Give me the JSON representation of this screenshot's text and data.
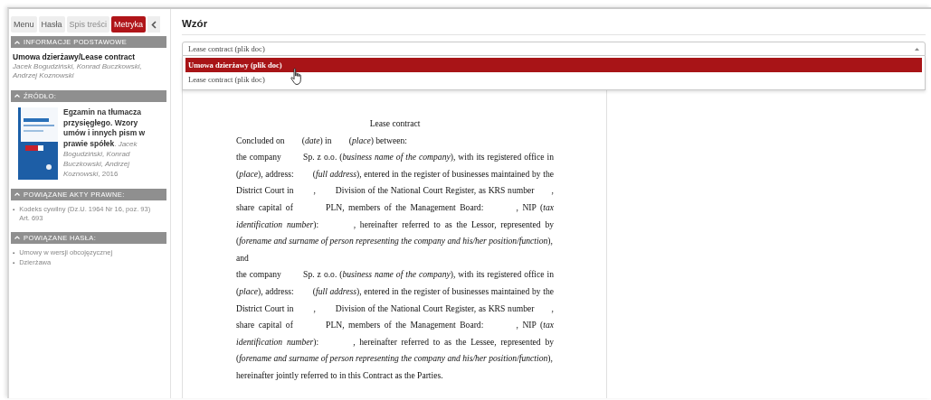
{
  "tabs": [
    {
      "label": "Menu",
      "selected": false,
      "disabled": false
    },
    {
      "label": "Hasła",
      "selected": false,
      "disabled": false
    },
    {
      "label": "Spis treści",
      "selected": false,
      "disabled": true
    },
    {
      "label": "Metryka",
      "selected": true,
      "disabled": false
    }
  ],
  "sidebar": {
    "sections": [
      {
        "kind": "info",
        "title": "INFORMACJE PODSTAWOWE",
        "heading": "Umowa dzierżawy/Lease contract",
        "authors": "Jacek Bogudziński, Konrad Buczkowski, Andrzej Koznowski"
      },
      {
        "kind": "source",
        "title": "ŹRÓDŁO:",
        "text": "**Egzamin na tłumacza przysięgłego. Wzory umów i innych pism w prawie spółek**. *Jacek Bogudziński, Konrad Buczkowski, Andrzej Koznowski*, 2016"
      },
      {
        "kind": "list",
        "title": "POWIĄZANE AKTY PRAWNE:",
        "items": [
          {
            "bullet": "▪",
            "lines": [
              "Kodeks cywilny (Dz.U. 1964 Nr 16, poz. 93)",
              "Art. 693"
            ]
          }
        ]
      },
      {
        "kind": "list",
        "title": "POWIĄZANE HASŁA:",
        "items": [
          {
            "bullet": "▪",
            "lines": [
              "Umowy w wersji obcojęzycznej"
            ]
          },
          {
            "bullet": "▪",
            "lines": [
              "Dzierżawa"
            ]
          }
        ]
      }
    ]
  },
  "main": {
    "title": "Wzór",
    "select": {
      "value": "Lease contract (plik doc)",
      "expanded": true,
      "options": [
        {
          "label": "Umowa dzierżawy (plik doc)",
          "highlighted": true
        },
        {
          "label": "Lease contract (plik doc)",
          "highlighted": false
        }
      ]
    },
    "document": {
      "title": "Lease contract",
      "paragraphs": [
        "Concluded on        (*date*) in        (*place*) between:",
        "the company        Sp. z o.o. (*business name of the company*), with its registered office in        (*place*), address:        (*full address*), entered in the register of businesses maintained by the District Court in        ,        Division of the National Court Register, as KRS number       , share capital of        PLN, members of the Management Board:        , NIP (*tax identification number*):        , hereinafter referred to as the Lessor, represented by        (*forename and surname of person representing the company and his/her position/function*),",
        "and",
        "the company        Sp. z o.o. (*business name of the company*), with its registered office in        (*place*), address:        (*full address*), entered in the register of businesses maintained by the District Court in        ,        Division of the National Court Register, as KRS number       , share capital of        PLN, members of the Management Board:        , NIP (*tax identification number*):        , hereinafter referred to as the Lessee, represented by        (*forename and surname of person representing the company and his/her position/function*),",
        "hereinafter jointly referred to in this Contract as the Parties."
      ]
    }
  }
}
